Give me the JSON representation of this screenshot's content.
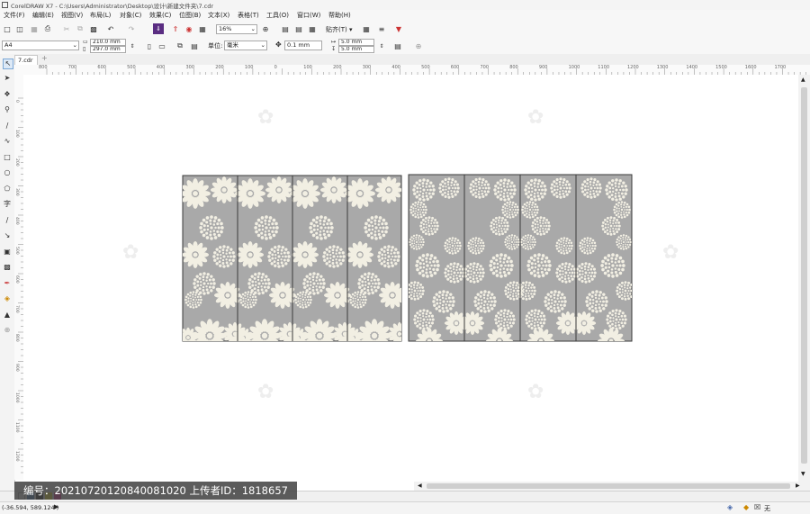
{
  "window": {
    "title": "CorelDRAW X7 - C:\\Users\\Administrator\\Desktop\\设计\\新建文件夹\\7.cdr"
  },
  "menu": [
    "文件(F)",
    "编辑(E)",
    "视图(V)",
    "布局(L)",
    "对象(C)",
    "效果(C)",
    "位图(B)",
    "文本(X)",
    "表格(T)",
    "工具(O)",
    "窗口(W)",
    "帮助(H)"
  ],
  "toolbar": {
    "zoom": "16%",
    "snap_label": "贴齐(T)"
  },
  "property_bar": {
    "page_size": "A4",
    "width": "210.0 mm",
    "height": "297.0 mm",
    "units_label": "单位:",
    "units_value": "毫米",
    "nudge": "0.1 mm",
    "dup_x": "5.0 mm",
    "dup_y": "5.0 mm"
  },
  "document_tab": {
    "name": "7.cdr"
  },
  "ruler": {
    "h_ticks": [
      "800",
      "700",
      "600",
      "500",
      "400",
      "300",
      "200",
      "100",
      "0",
      "100",
      "200",
      "300",
      "400",
      "500",
      "600",
      "700",
      "800",
      "900",
      "1000",
      "1100",
      "1200",
      "1300",
      "1400",
      "1500",
      "1600",
      "1700"
    ],
    "v_ticks": [
      "0",
      "100",
      "200",
      "300",
      "400",
      "500",
      "600",
      "700",
      "800",
      "900",
      "1000",
      "1100",
      "1200",
      "1300",
      "1400"
    ],
    "unit": "毫米"
  },
  "status": {
    "coords": "(-36.594, 589.124 )",
    "fill_label": "无"
  },
  "watermark": {
    "text": "编号：20210720120840081020  上传者ID：1818657"
  },
  "colors": {
    "panel_fill": "#a9a9a9",
    "flower_fill": "#f2efe3",
    "panel_stroke": "#3a3a3a"
  }
}
